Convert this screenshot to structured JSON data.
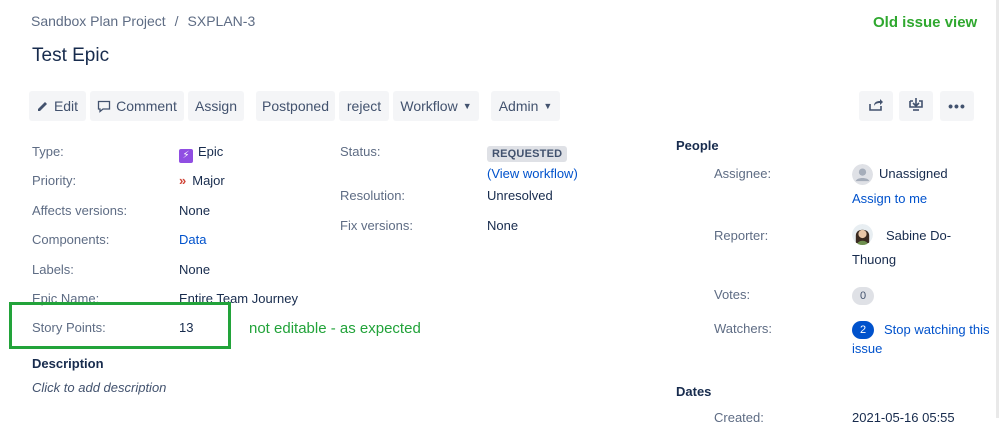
{
  "breadcrumb": {
    "project": "Sandbox Plan Project",
    "separator": "/",
    "issue_key": "SXPLAN-3"
  },
  "annotation_top": "Old issue view",
  "annotation_mid": "not editable - as expected",
  "title": "Test Epic",
  "toolbar": {
    "edit": "Edit",
    "comment": "Comment",
    "assign": "Assign",
    "postponed": "Postponed",
    "reject": "reject",
    "workflow": "Workflow",
    "admin": "Admin",
    "share_icon": "share-icon",
    "export_icon": "export-icon",
    "more": "•••"
  },
  "details": {
    "type_label": "Type:",
    "type_value": "Epic",
    "priority_label": "Priority:",
    "priority_value": "Major",
    "affects_label": "Affects versions:",
    "affects_value": "None",
    "components_label": "Components:",
    "components_value": "Data",
    "labels_label": "Labels:",
    "labels_value": "None",
    "epic_name_label": "Epic Name:",
    "epic_name_value": "Entire Team Journey",
    "story_points_label": "Story Points:",
    "story_points_value": "13",
    "status_label": "Status:",
    "status_value": "REQUESTED",
    "view_workflow": "(View workflow)",
    "resolution_label": "Resolution:",
    "resolution_value": "Unresolved",
    "fix_label": "Fix versions:",
    "fix_value": "None"
  },
  "description": {
    "heading": "Description",
    "placeholder": "Click to add description"
  },
  "people": {
    "heading": "People",
    "assignee_label": "Assignee:",
    "assignee_value": "Unassigned",
    "assign_to_me": "Assign to me",
    "reporter_label": "Reporter:",
    "reporter_first": "Sabine Do-",
    "reporter_second": "Thuong",
    "votes_label": "Votes:",
    "votes_count": "0",
    "watchers_label": "Watchers:",
    "watchers_count": "2",
    "stop_watching_1": "Stop watching this",
    "stop_watching_2": "issue"
  },
  "dates": {
    "heading": "Dates",
    "created_label": "Created:",
    "created_value": "2021-05-16 05:55"
  },
  "colors": {
    "accent": "#0052cc",
    "annotation": "#22a33a",
    "epic": "#904ee2",
    "priority": "#d04437"
  }
}
